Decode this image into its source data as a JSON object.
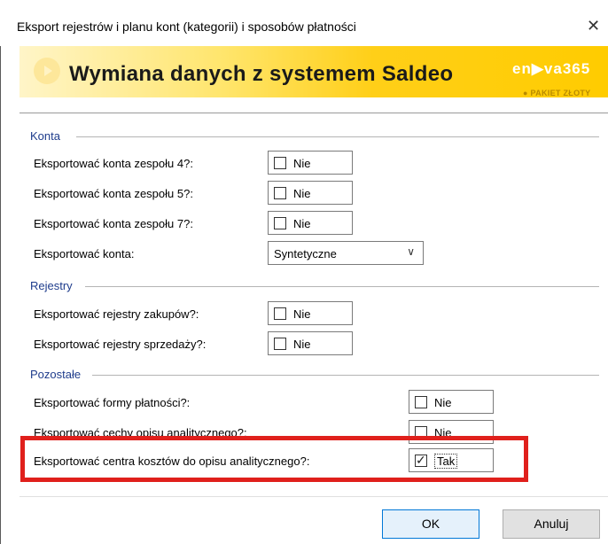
{
  "window": {
    "title": "Eksport rejestrów i planu kont (kategorii) i sposobów płatności"
  },
  "banner": {
    "title": "Wymiana danych z systemem Saldeo",
    "brand": "en▶va365",
    "subtitle": "● PAKIET ZŁOTY"
  },
  "groups": {
    "konta": "Konta",
    "rejestry": "Rejestry",
    "pozostale": "Pozostałe"
  },
  "fields": {
    "konta4": {
      "label": "Eksportować konta zespołu 4?:",
      "value": "Nie",
      "checked": false
    },
    "konta5": {
      "label": "Eksportować konta zespołu 5?:",
      "value": "Nie",
      "checked": false
    },
    "konta7": {
      "label": "Eksportować konta zespołu 7?:",
      "value": "Nie",
      "checked": false
    },
    "konta": {
      "label": "Eksportować konta:",
      "value": "Syntetyczne"
    },
    "zakupy": {
      "label": "Eksportować rejestry zakupów?:",
      "value": "Nie",
      "checked": false
    },
    "sprzedaz": {
      "label": "Eksportować rejestry sprzedaży?:",
      "value": "Nie",
      "checked": false
    },
    "formy": {
      "label": "Eksportować formy płatności?:",
      "value": "Nie",
      "checked": false
    },
    "cechy": {
      "label": "Eksportować cechy opisu analitycznego?:",
      "value": "Nie",
      "checked": false
    },
    "centra": {
      "label": "Eksportować centra kosztów do opisu analitycznego?:",
      "value": "Tak",
      "checked": true
    }
  },
  "buttons": {
    "ok": "OK",
    "cancel": "Anuluj"
  },
  "colors": {
    "highlight": "#e0201c",
    "group_label": "#1e3c8c",
    "banner_accent": "#ffcc00"
  }
}
